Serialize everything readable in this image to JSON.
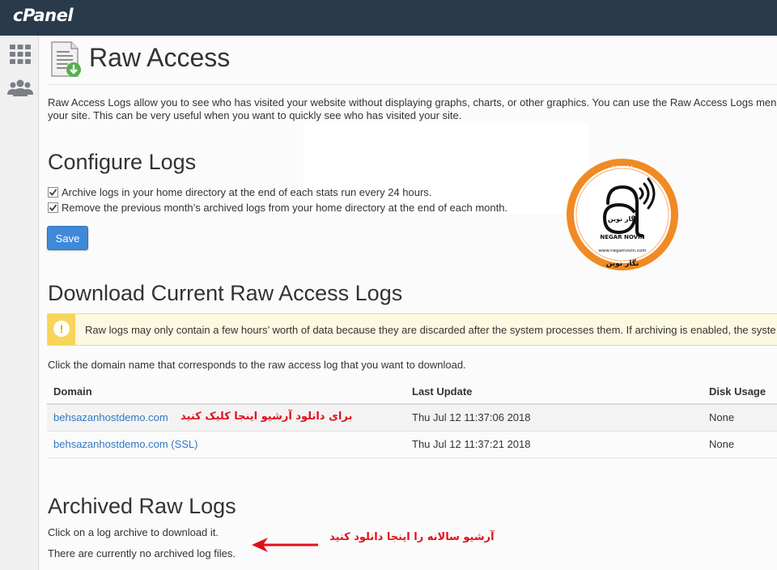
{
  "app": {
    "brand": "cPanel"
  },
  "colors": {
    "topbar": "#293a4a",
    "link": "#3177c2",
    "primary": "#3f89d9",
    "warning": "#f8d459",
    "annotation": "#e0101b"
  },
  "sidebar": {
    "items": [
      {
        "icon": "grid-icon"
      },
      {
        "icon": "users-icon"
      }
    ]
  },
  "page": {
    "title": "Raw Access",
    "icon": "raw-access-download-icon",
    "intro_line1": "Raw Access Logs allow you to see who has visited your website without displaying graphs, charts, or other graphics. You can use the Raw Access Logs menu",
    "intro_line2": "your site. This can be very useful when you want to quickly see who has visited your site."
  },
  "configure": {
    "heading": "Configure Logs",
    "options": [
      {
        "label": "Archive logs in your home directory at the end of each stats run every 24 hours.",
        "checked": true
      },
      {
        "label": "Remove the previous month’s archived logs from your home directory at the end of each month.",
        "checked": true
      }
    ],
    "save_label": "Save"
  },
  "watermark": {
    "fa_line1": "نگار نوین",
    "brand": "NEGAR NOVIN",
    "url": "www.negarnovin.com",
    "fa_line2": "نگار نوین"
  },
  "download": {
    "heading": "Download Current Raw Access Logs",
    "alert_text": "Raw logs may only contain a few hours’ worth of data because they are discarded after the system processes them. If archiving is enabled, the syste",
    "instruction": "Click the domain name that corresponds to the raw access log that you want to download.",
    "columns": {
      "domain": "Domain",
      "last_update": "Last Update",
      "disk_usage": "Disk Usage"
    },
    "rows": [
      {
        "domain": "behsazanhostdemo.com",
        "last_update": "Thu Jul 12 11:37:06 2018",
        "disk_usage": "None"
      },
      {
        "domain": "behsazanhostdemo.com (SSL)",
        "last_update": "Thu Jul 12 11:37:21 2018",
        "disk_usage": "None"
      }
    ]
  },
  "archived": {
    "heading": "Archived Raw Logs",
    "instruction": "Click on a log archive to download it.",
    "empty_text": "There are currently no archived log files."
  },
  "annotations": {
    "download_archive": "برای دانلود آرشیو اینجا کلیک کنید",
    "yearly_archive": "آرشیو سالانه را اینجا دانلود کنید"
  }
}
